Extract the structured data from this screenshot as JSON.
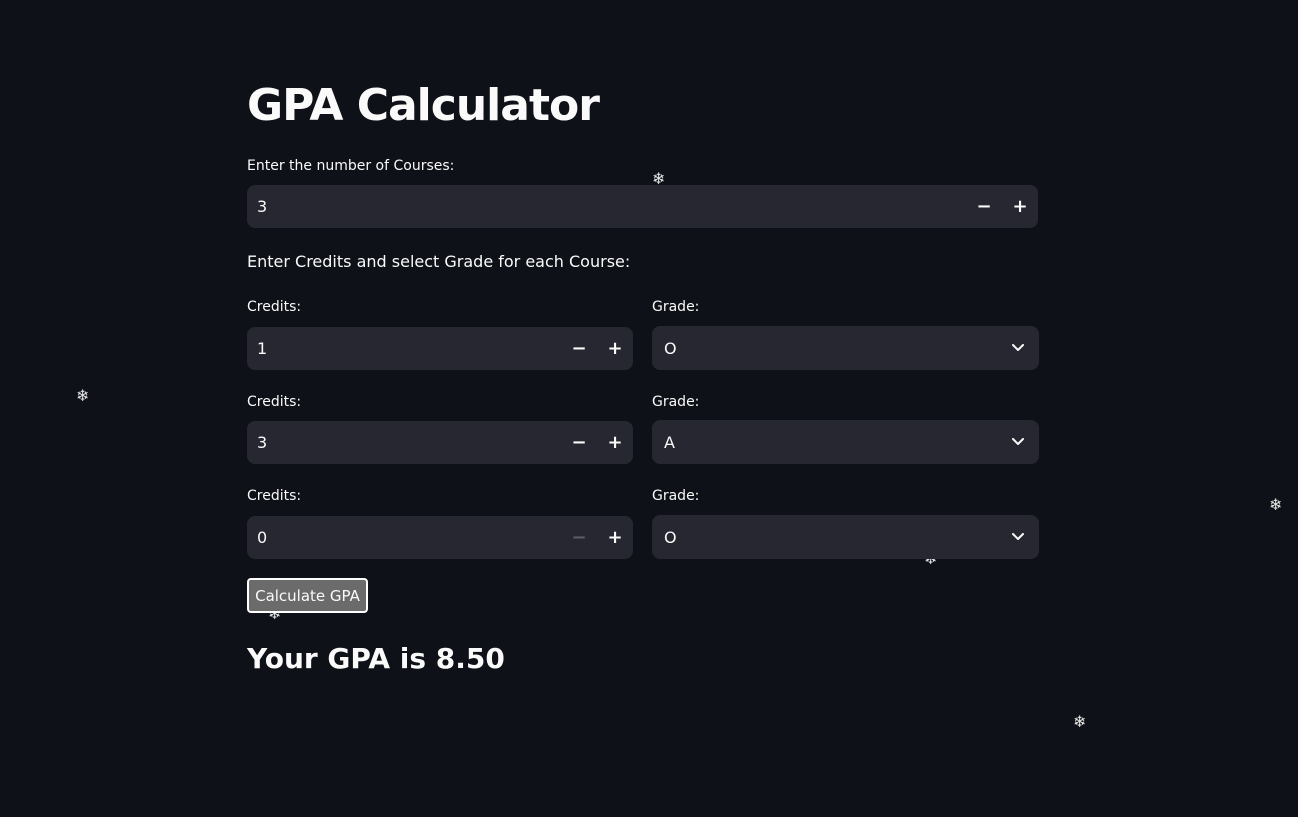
{
  "page": {
    "title": "GPA Calculator",
    "courses_label": "Enter the number of Courses:",
    "courses_value": "3",
    "instructions": "Enter Credits and select Grade for each Course:",
    "calculate_label": "Calculate GPA",
    "result_text": "Your GPA is 8.50"
  },
  "stepper": {
    "minus": "−",
    "plus": "+"
  },
  "courses": [
    {
      "credits_label": "Credits:",
      "credits_value": "1",
      "grade_label": "Grade:",
      "grade_value": "O"
    },
    {
      "credits_label": "Credits:",
      "credits_value": "3",
      "grade_label": "Grade:",
      "grade_value": "A"
    },
    {
      "credits_label": "Credits:",
      "credits_value": "0",
      "grade_label": "Grade:",
      "grade_value": "O"
    }
  ],
  "decor": {
    "snowflake": "❄"
  },
  "colors": {
    "background": "#0e1117",
    "input_bg": "#262730",
    "text": "#fafafa",
    "button_bg": "#6b6b6b"
  }
}
